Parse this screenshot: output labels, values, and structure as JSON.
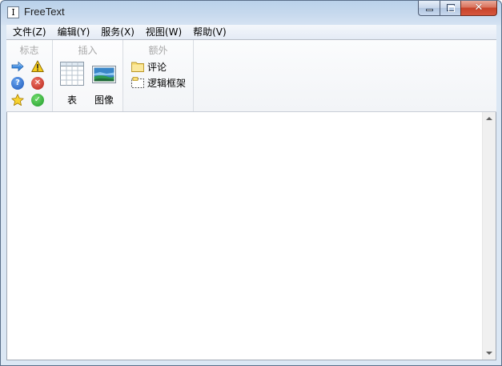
{
  "window": {
    "title": "FreeText",
    "icon_glyph": "I"
  },
  "menu": [
    {
      "label": "文件(Z)"
    },
    {
      "label": "编辑(Y)"
    },
    {
      "label": "服务(X)"
    },
    {
      "label": "视图(W)"
    },
    {
      "label": "帮助(V)"
    }
  ],
  "toolbar": {
    "flags": {
      "label": "标志",
      "icons": [
        "arrow-right-icon",
        "warning-icon",
        "help-icon",
        "error-icon",
        "star-icon",
        "check-icon"
      ]
    },
    "insert": {
      "label": "插入",
      "table_label": "表",
      "image_label": "图像"
    },
    "extra": {
      "label": "额外",
      "comment_label": "评论",
      "frame_label": "逻辑框架"
    }
  },
  "colors": {
    "accent": "#3d7bd0",
    "error": "#d23a2c",
    "success": "#2ea83a",
    "warning": "#f3c200"
  }
}
